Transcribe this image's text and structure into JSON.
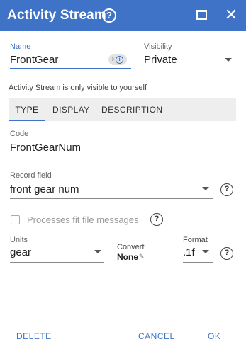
{
  "dialog": {
    "title": "Activity Stream",
    "help_symbol": "?",
    "close_symbol": "✕"
  },
  "name_field": {
    "label": "Name",
    "value": "FrontGear",
    "chevron": "›",
    "info": "i"
  },
  "visibility_field": {
    "label": "Visibility",
    "value": "Private"
  },
  "visibility_note": "Activity Stream is only visible to yourself",
  "tabs": [
    {
      "label": "TYPE",
      "active": true
    },
    {
      "label": "DISPLAY",
      "active": false
    },
    {
      "label": "DESCRIPTION",
      "active": false
    }
  ],
  "code_field": {
    "label": "Code",
    "value": "FrontGearNum"
  },
  "record_field": {
    "label": "Record field",
    "value": "front gear num"
  },
  "processes_fit": {
    "label": "Processes fit file messages",
    "checked": false
  },
  "units_field": {
    "label": "Units",
    "value": "gear"
  },
  "convert_field": {
    "label": "Convert",
    "value": "None",
    "edit_symbol": "✎"
  },
  "format_field": {
    "label": "Format",
    "value": ".1f"
  },
  "help_symbol": "?",
  "buttons": {
    "delete": "DELETE",
    "cancel": "CANCEL",
    "ok": "OK"
  },
  "colors": {
    "accent": "#3f73c8",
    "tab_bg": "#eeeeee"
  }
}
